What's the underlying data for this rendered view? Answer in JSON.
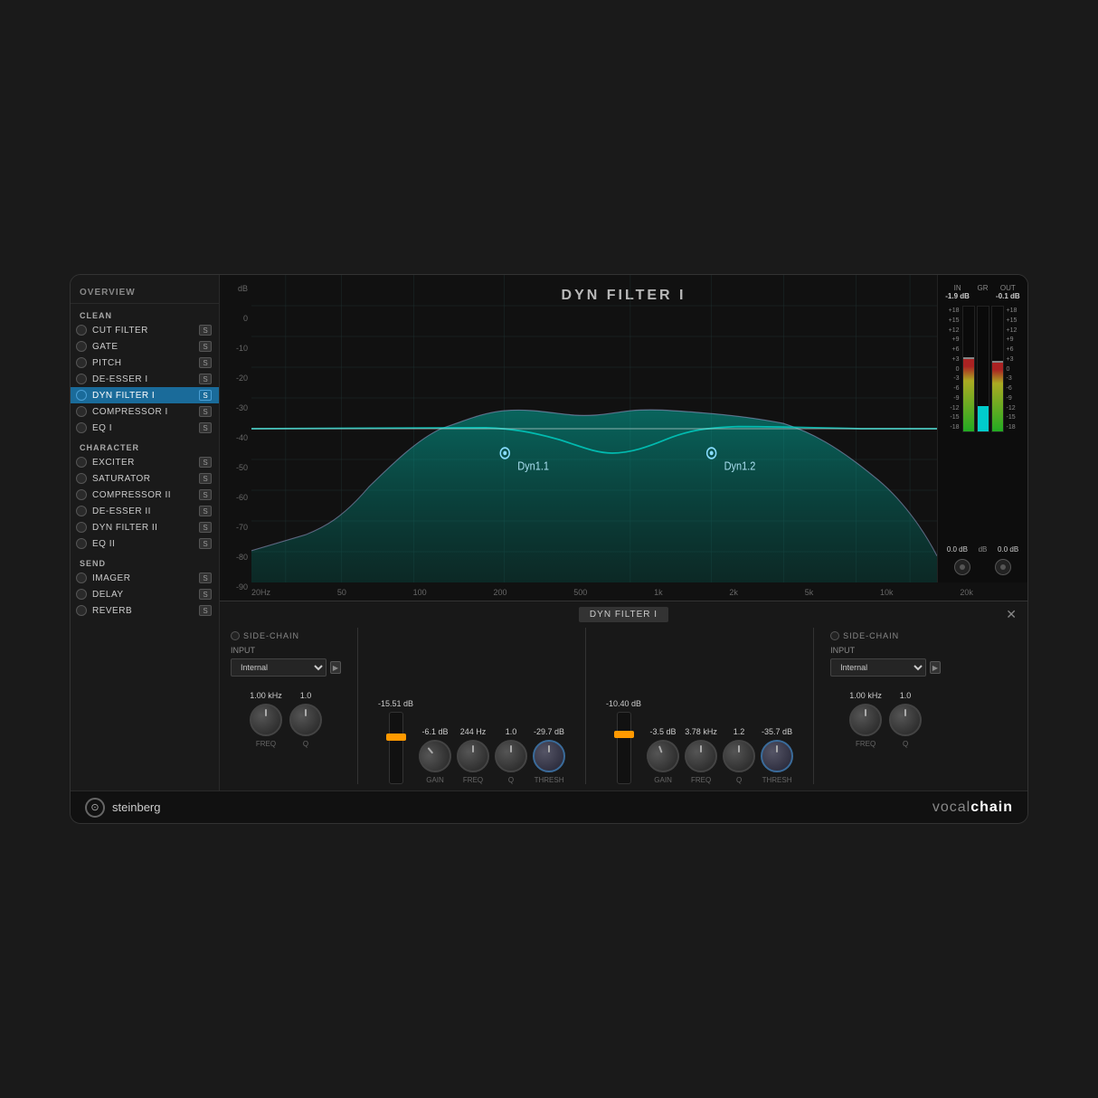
{
  "plugin": {
    "title": "vocalchain",
    "brand": "steinberg"
  },
  "header": {
    "title": "DYN FILTER I"
  },
  "sidebar": {
    "overview_label": "OVERVIEW",
    "sections": [
      {
        "label": "CLEAN",
        "items": [
          {
            "id": "cut-filter",
            "label": "CUT FILTER",
            "active": false,
            "s": true
          },
          {
            "id": "gate",
            "label": "GATE",
            "active": false,
            "s": true
          },
          {
            "id": "pitch",
            "label": "PITCH",
            "active": false,
            "s": true
          },
          {
            "id": "de-esser-i",
            "label": "DE-ESSER I",
            "active": false,
            "s": true
          },
          {
            "id": "dyn-filter-i",
            "label": "DYN FILTER I",
            "active": true,
            "s": true
          },
          {
            "id": "compressor-i",
            "label": "COMPRESSOR I",
            "active": false,
            "s": true
          },
          {
            "id": "eq-i",
            "label": "EQ I",
            "active": false,
            "s": true
          }
        ]
      },
      {
        "label": "CHARACTER",
        "items": [
          {
            "id": "exciter",
            "label": "EXCITER",
            "active": false,
            "s": true
          },
          {
            "id": "saturator",
            "label": "SATURATOR",
            "active": false,
            "s": true
          },
          {
            "id": "compressor-ii",
            "label": "COMPRESSOR II",
            "active": false,
            "s": true
          },
          {
            "id": "de-esser-ii",
            "label": "DE-ESSER II",
            "active": false,
            "s": true
          },
          {
            "id": "dyn-filter-ii",
            "label": "DYN FILTER II",
            "active": false,
            "s": true
          },
          {
            "id": "eq-ii",
            "label": "EQ II",
            "active": false,
            "s": true
          }
        ]
      },
      {
        "label": "SEND",
        "items": [
          {
            "id": "imager",
            "label": "IMAGER",
            "active": false,
            "s": true
          },
          {
            "id": "delay",
            "label": "DELAY",
            "active": false,
            "s": true
          },
          {
            "id": "reverb",
            "label": "REVERB",
            "active": false,
            "s": true
          }
        ]
      }
    ]
  },
  "spectrum": {
    "title": "DYN FILTER I",
    "y_labels": [
      "dB",
      "0",
      "-10",
      "-20",
      "-30",
      "-40",
      "-50",
      "-60",
      "-70",
      "-80",
      "-90"
    ],
    "x_labels": [
      "20Hz",
      "50",
      "100",
      "200",
      "500",
      "1k",
      "2k",
      "5k",
      "10k",
      "20k"
    ],
    "dyn_points": [
      {
        "id": "dyn1",
        "label": "Dyn1.1",
        "x_pct": 37,
        "y_pct": 62
      },
      {
        "id": "dyn2",
        "label": "Dyn1.2",
        "x_pct": 67,
        "y_pct": 62
      }
    ]
  },
  "meters": {
    "in_label": "IN",
    "in_value": "-1.9 dB",
    "gr_label": "GR",
    "gr_value": "",
    "out_label": "OUT",
    "out_value": "-0.1 dB",
    "scale": [
      "+18",
      "+15",
      "+12",
      "+9",
      "+6",
      "+3",
      "0",
      "-3",
      "-6",
      "-9",
      "-12",
      "-15",
      "-18"
    ],
    "in_level": 58,
    "gr_level": 22,
    "out_level": 55,
    "bottom_in": "0.0 dB",
    "bottom_out": "0.0 dB",
    "bottom_db": "dB"
  },
  "bottom_panel": {
    "title": "DYN FILTER I",
    "left_section": {
      "side_chain_label": "SIDE-CHAIN",
      "input_label": "INPUT",
      "input_value": "Internal",
      "freq_value": "1.00 kHz",
      "q_value": "1.0"
    },
    "dyn1": {
      "gain_value": "-6.1 dB",
      "freq_value": "244 Hz",
      "q_value": "1.0",
      "thresh_value": "-29.7 dB",
      "fader_value": "-15.51 dB",
      "gain_label": "GAIN",
      "freq_label": "FREQ",
      "q_label": "Q",
      "thresh_label": "THRESH"
    },
    "dyn2": {
      "gain_value": "-3.5 dB",
      "freq_value": "3.78 kHz",
      "q_value": "1.2",
      "thresh_value": "-35.7 dB",
      "fader_value": "-10.40 dB",
      "gain_label": "GAIN",
      "freq_label": "FREQ",
      "q_label": "Q",
      "thresh_label": "THRESH"
    },
    "right_section": {
      "side_chain_label": "SIDE-CHAIN",
      "input_label": "INPUT",
      "input_value": "Internal",
      "freq_value": "1.00 kHz",
      "q_value": "1.0"
    }
  },
  "footer": {
    "brand": "steinberg",
    "product": "vocalchain"
  }
}
